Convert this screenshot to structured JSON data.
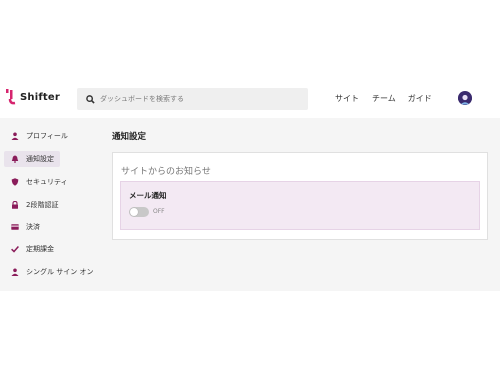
{
  "header": {
    "logo_text": "Shifter",
    "search": {
      "placeholder": "ダッシュボードを検索する"
    },
    "nav": [
      "サイト",
      "チーム",
      "ガイド"
    ]
  },
  "sidebar": {
    "items": [
      {
        "label": "プロフィール",
        "icon": "user-icon",
        "active": false
      },
      {
        "label": "通知設定",
        "icon": "bell-icon",
        "active": true
      },
      {
        "label": "セキュリティ",
        "icon": "shield-icon",
        "active": false
      },
      {
        "label": "2段階認証",
        "icon": "lock-icon",
        "active": false
      },
      {
        "label": "決済",
        "icon": "credit-card-icon",
        "active": false
      },
      {
        "label": "定期課金",
        "icon": "check-icon",
        "active": false
      },
      {
        "label": "シングル サイン オン",
        "icon": "user-icon",
        "active": false
      }
    ]
  },
  "main": {
    "title": "通知設定",
    "card": {
      "title": "サイトからのお知らせ",
      "email": {
        "label": "メール通知",
        "toggle_state": "OFF"
      }
    }
  },
  "colors": {
    "brand": "#d6246e",
    "active_bg": "#e9e3ec",
    "email_bg": "#f3e9f3"
  }
}
